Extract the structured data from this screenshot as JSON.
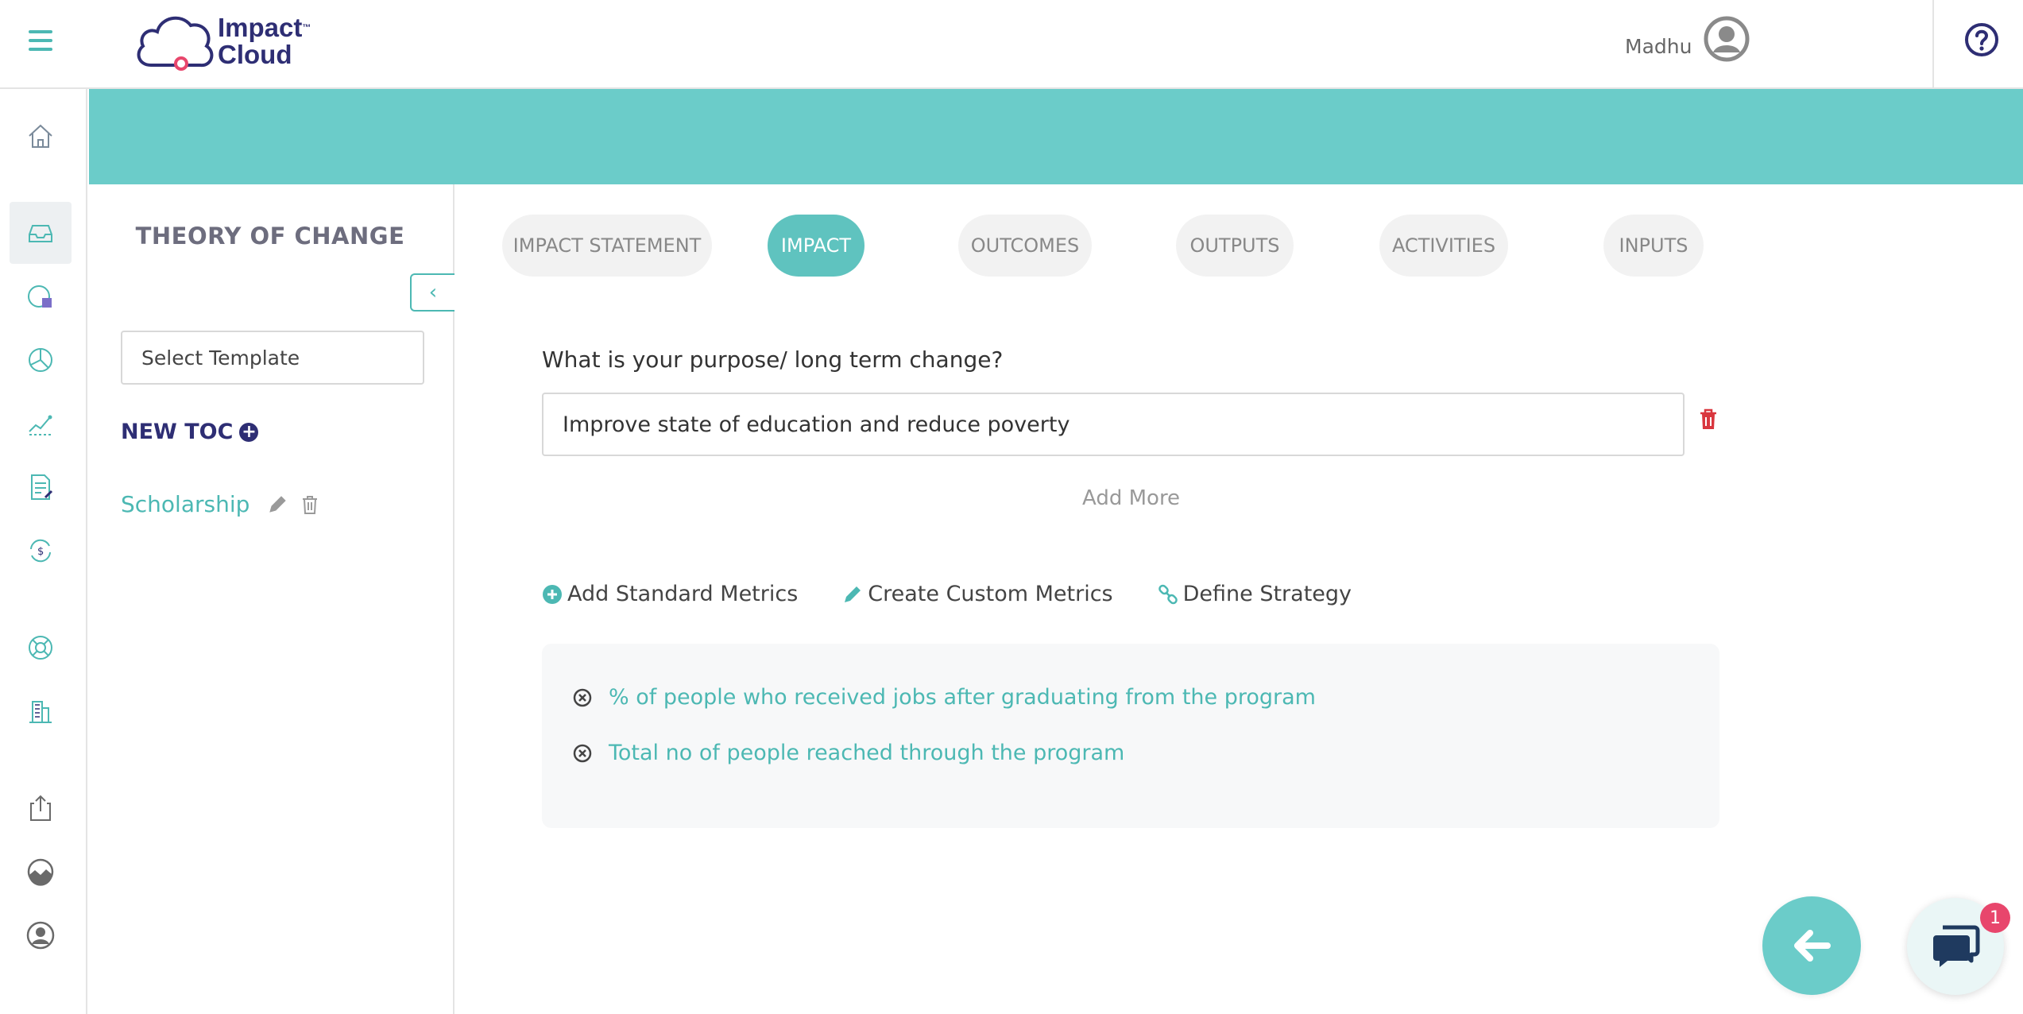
{
  "header": {
    "logo_text_line1": "Impact",
    "logo_tm": "™",
    "logo_text_line2": "Cloud",
    "user_name": "Madhu"
  },
  "rail": {
    "items": [
      {
        "icon": "home-icon"
      },
      {
        "icon": "inbox-icon",
        "active": true
      },
      {
        "icon": "globe-doc-icon"
      },
      {
        "icon": "pie-chart-icon"
      },
      {
        "icon": "trend-chart-icon"
      },
      {
        "icon": "edit-document-icon"
      },
      {
        "icon": "currency-cycle-icon"
      },
      {
        "icon": "lifebuoy-icon"
      },
      {
        "icon": "buildings-icon"
      },
      {
        "icon": "export-icon"
      },
      {
        "icon": "landscape-icon"
      },
      {
        "icon": "user-icon"
      }
    ]
  },
  "panel": {
    "title": "THEORY OF CHANGE",
    "select_template": "Select Template",
    "new_toc_label": "NEW TOC",
    "toc_items": [
      "Scholarship"
    ]
  },
  "tabs": [
    {
      "label": "IMPACT STATEMENT"
    },
    {
      "label": "IMPACT",
      "active": true
    },
    {
      "label": "OUTCOMES"
    },
    {
      "label": "OUTPUTS"
    },
    {
      "label": "ACTIVITIES"
    },
    {
      "label": "INPUTS"
    }
  ],
  "form": {
    "question": "What is your purpose/ long term change?",
    "answer_value": "Improve state of education and reduce poverty",
    "add_more": "Add More"
  },
  "metric_actions": {
    "add_standard": "Add Standard Metrics",
    "create_custom": "Create Custom Metrics",
    "define_strategy": "Define Strategy"
  },
  "metrics": [
    "% of people who received jobs after graduating from the program",
    "Total no of people reached through the program"
  ],
  "chat": {
    "badge_count": "1"
  },
  "colors": {
    "teal": "#6bccc9",
    "accent": "#4cb8b3",
    "navy": "#2e2e74",
    "danger": "#d9363e",
    "badge": "#e8466c"
  }
}
